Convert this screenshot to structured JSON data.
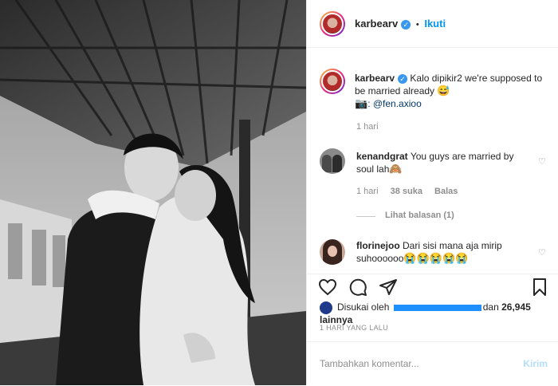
{
  "post": {
    "username": "karbearv",
    "follow_label": "Ikuti",
    "caption_text": "Kalo dipikir2 we're supposed to be married already",
    "caption_emoji": "😅",
    "caption_camera": "📷",
    "caption_mention": ": @fen.axioo",
    "caption_time": "1 hari"
  },
  "comments": [
    {
      "username": "kenandgrat",
      "text": "You guys are married by soul lah",
      "emoji": "🙈",
      "time": "1 hari",
      "likes": "38 suka",
      "reply_label": "Balas",
      "view_replies": "Lihat balasan (1)"
    },
    {
      "username": "florinejoo",
      "text": "Dari sisi mana aja mirip suhoooooo",
      "emoji": "😭😭😭😭😭"
    }
  ],
  "likes": {
    "prefix": "Disukai oleh",
    "middle": "dan",
    "count": "26,945 lainnya"
  },
  "date": "1 HARI YANG LALU",
  "add_comment": {
    "placeholder": "Tambahkan komentar...",
    "post_label": "Kirim"
  },
  "colors": {
    "link_blue": "#0095f6",
    "verified_blue": "#3897f0",
    "muted_gray": "#8e8e8e"
  }
}
